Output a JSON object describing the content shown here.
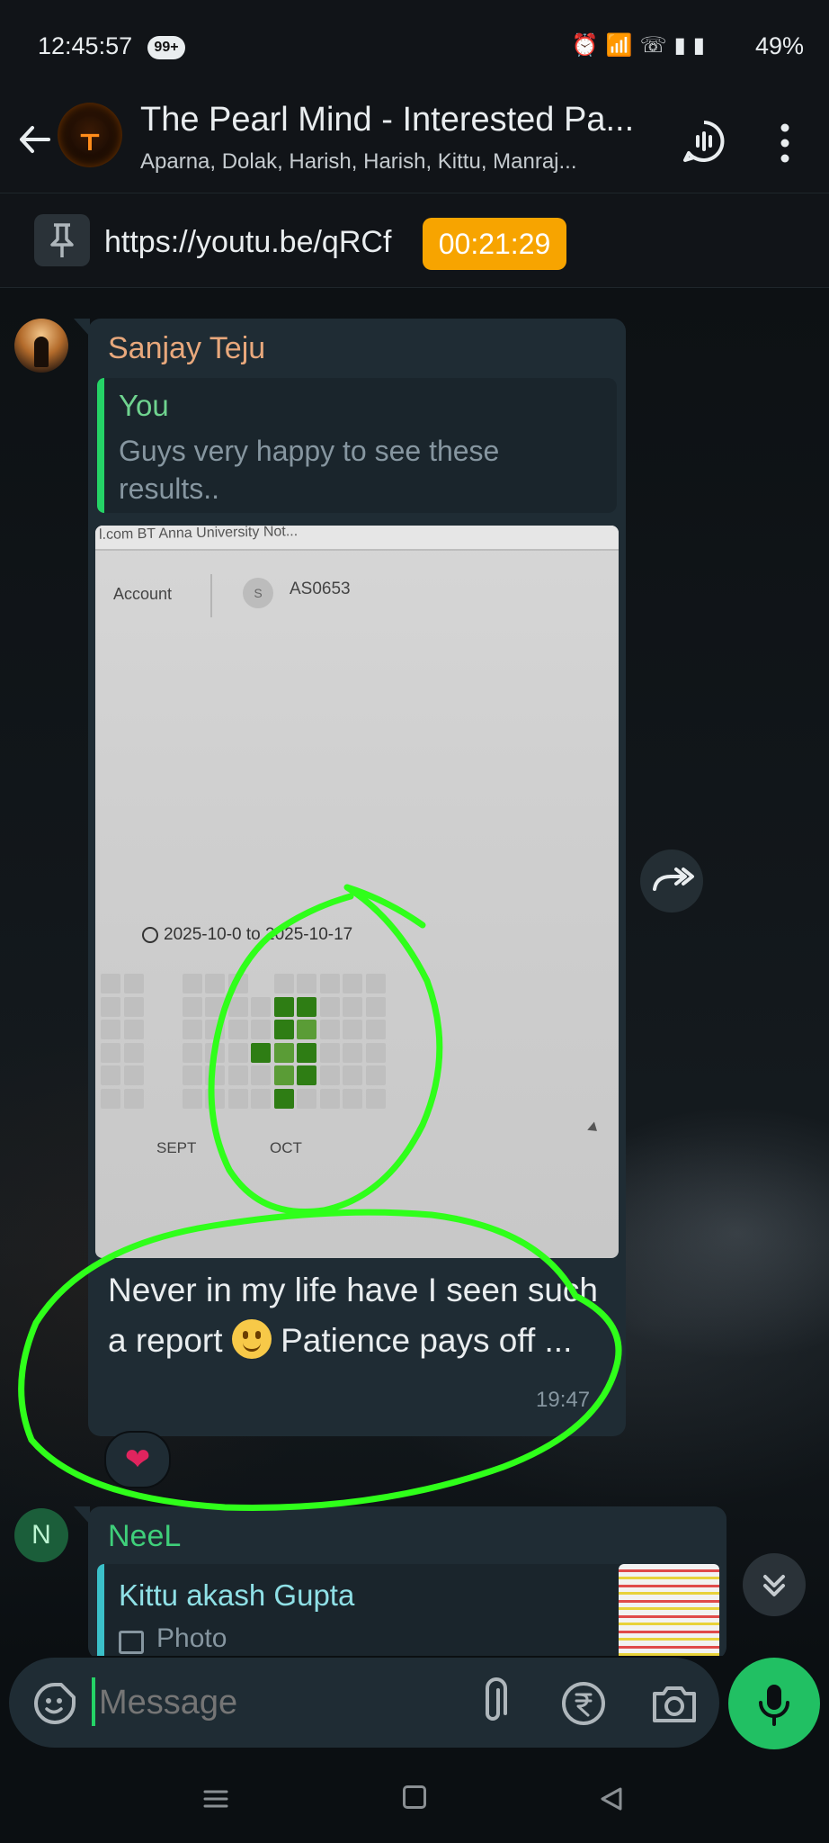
{
  "status_bar": {
    "time": "12:45:57",
    "notification_badge": "99+",
    "battery": "49%"
  },
  "header": {
    "title": "The Pearl Mind - Interested Pa...",
    "subtitle": "Aparna, Dolak, Harish, Harish, Kittu, Manraj...",
    "avatar_glyph": "ᚁ"
  },
  "pinned": {
    "text": "https://youtu.be/qRCf",
    "timer": "00:21:29"
  },
  "message1": {
    "sender": "Sanjay Teju",
    "quote_author": "You",
    "quote_text": "Guys very happy to see these results..",
    "photo": {
      "browser_text": "l.com  BT  Anna University Not...",
      "account_label": "Account",
      "circle_initial": "S",
      "account_id": "AS0653",
      "date_range": "2025-10-0 to 2025-10-17",
      "month1": "SEPT",
      "month2": "OCT"
    },
    "text_before_emoji": "Never in my life have I seen such a report ",
    "text_after_emoji": " Patience pays off ...",
    "time": "19:47",
    "reaction": "❤"
  },
  "message2": {
    "avatar_letter": "N",
    "sender": "NeeL",
    "quote_author": "Kittu akash Gupta",
    "quote_text": "Photo"
  },
  "input": {
    "placeholder": "Message"
  },
  "colors": {
    "accent_green": "#21c063",
    "annotation_green": "#2fff1a",
    "timer_orange": "#f7a400",
    "bubble": "#1f2c34"
  }
}
